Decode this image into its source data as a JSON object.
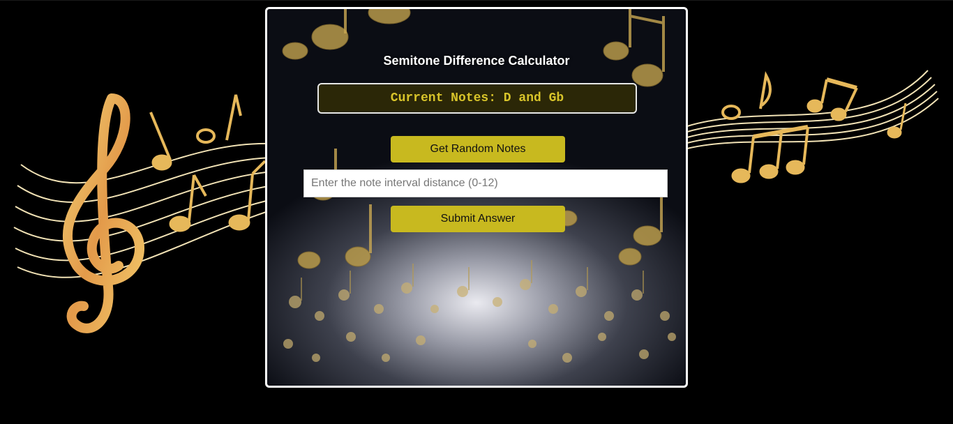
{
  "calculator": {
    "title": "Semitone Difference Calculator",
    "current_notes_label": "Current Notes: D and Gb",
    "random_button_label": "Get Random Notes",
    "interval_input": {
      "value": "",
      "placeholder": "Enter the note interval distance (0-12)"
    },
    "submit_button_label": "Submit Answer"
  },
  "decorations": {
    "left": "treble-clef-staff-illustration",
    "right": "music-staff-notes-illustration",
    "card_background": "golden-music-notes-background"
  },
  "colors": {
    "page_background": "#000000",
    "accent_gold": "#c8b91f",
    "notes_text": "#d8c42a",
    "notes_box_background": "#2b2707",
    "ornament_gold": "#e6b85a"
  }
}
